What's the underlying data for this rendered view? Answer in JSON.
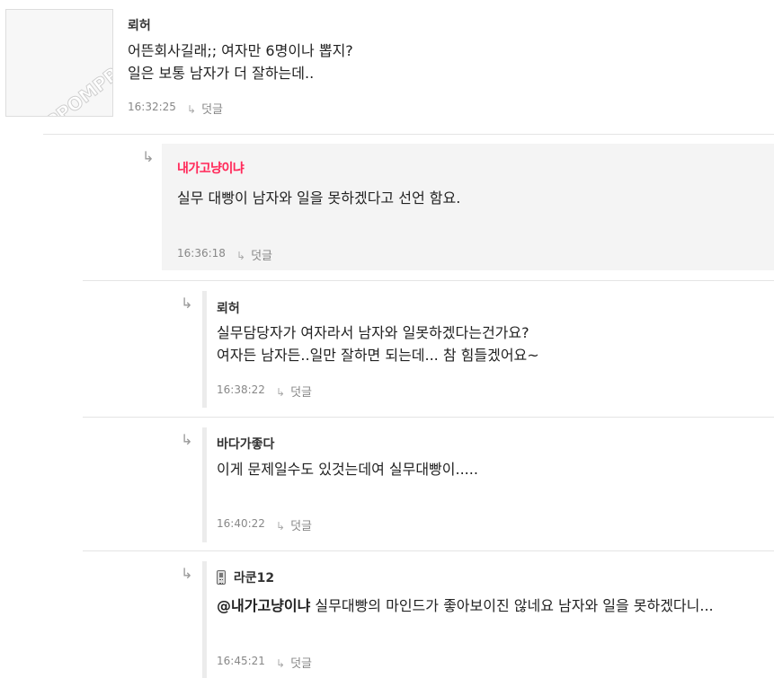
{
  "watermark": "PPOMPPU",
  "reply_label": "덧글",
  "comments": [
    {
      "nick": "뢰허",
      "lines": [
        "어뜬회사길래;; 여자만 6명이나 뽑지?",
        "일은 보통 남자가 더 잘하는데.."
      ],
      "time": "16:32:25"
    },
    {
      "nick": "내가고냥이냐",
      "lines": [
        "실무 대빵이 남자와 일을 못하겠다고 선언 함요."
      ],
      "time": "16:36:18"
    },
    {
      "nick": "뢰허",
      "lines": [
        "실무담당자가 여자라서 남자와 일못하겠다는건가요?",
        "여자든 남자든..일만 잘하면 되는데... 참 힘들겠어요~"
      ],
      "time": "16:38:22"
    },
    {
      "nick": "바다가좋다",
      "lines": [
        "이게 문제일수도 있것는데여 실무대빵이....."
      ],
      "time": "16:40:22"
    },
    {
      "nick": "라쿤12",
      "mention": "@내가고냥이냐",
      "text": " 실무대빵의 마인드가 좋아보이진 않네요 남자와 일을 못하겠다니...",
      "time": "16:45:21"
    }
  ]
}
